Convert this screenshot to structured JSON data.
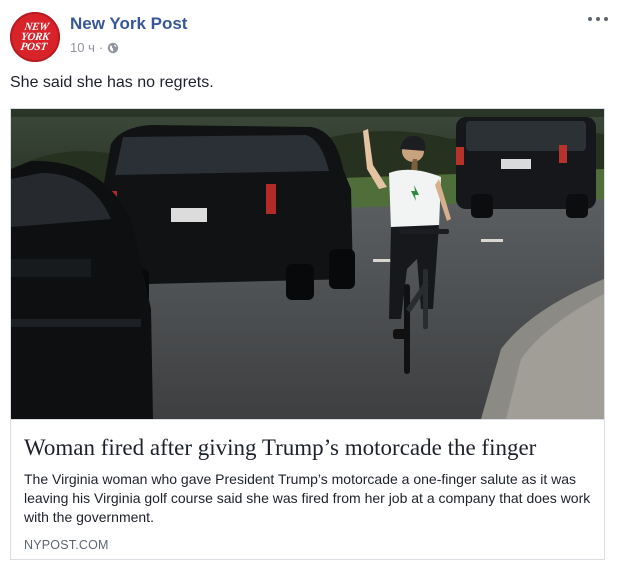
{
  "header": {
    "avatar_logo_lines": [
      "NEW",
      "YORK",
      "POST"
    ],
    "page_name": "New York Post",
    "timestamp": "10 ч",
    "separator": "·",
    "audience_icon": "globe-icon",
    "menu_icon": "more-options-icon"
  },
  "post": {
    "text": "She said she has no regrets."
  },
  "link_card": {
    "image_icon": "photo-woman-on-bicycle",
    "headline": "Woman fired after giving Trump’s motorcade the finger",
    "description": "The Virginia woman who gave President Trump’s motorcade a one-finger salute as it was leaving his Virginia golf course said she was fired from her job at a company that does work with the government.",
    "domain": "NYPOST.COM"
  },
  "colors": {
    "brand_red": "#d8232a",
    "link_blue": "#365899",
    "muted_gray": "#90949c"
  }
}
